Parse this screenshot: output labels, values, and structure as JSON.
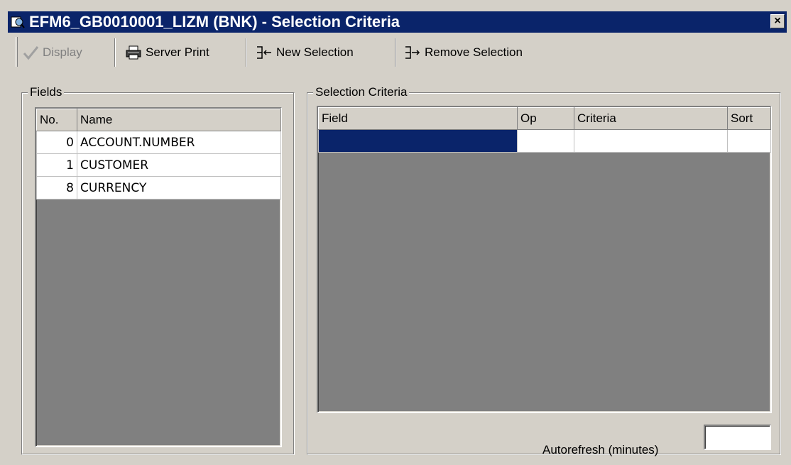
{
  "window": {
    "title": "EFM6_GB0010001_LIZM (BNK) - Selection Criteria",
    "close_symbol": "×",
    "titlebar_color": "#0a246a"
  },
  "toolbar": {
    "display_label": "Display",
    "server_print_label": "Server Print",
    "new_selection_label": "New Selection",
    "remove_selection_label": "Remove Selection"
  },
  "fields_panel": {
    "legend": "Fields",
    "columns": [
      "No.",
      "Name"
    ],
    "rows": [
      {
        "no": "0",
        "name": "ACCOUNT.NUMBER"
      },
      {
        "no": "1",
        "name": "CUSTOMER"
      },
      {
        "no": "8",
        "name": "CURRENCY"
      }
    ]
  },
  "criteria_panel": {
    "legend": "Selection Criteria",
    "columns": [
      "Field",
      "Op",
      "Criteria",
      "Sort"
    ],
    "rows": [
      {
        "field": "",
        "op": "",
        "criteria": "",
        "sort": ""
      }
    ],
    "selection_color": "#0a246a"
  },
  "autorefresh": {
    "label": "Autorefresh (minutes)",
    "value": ""
  }
}
